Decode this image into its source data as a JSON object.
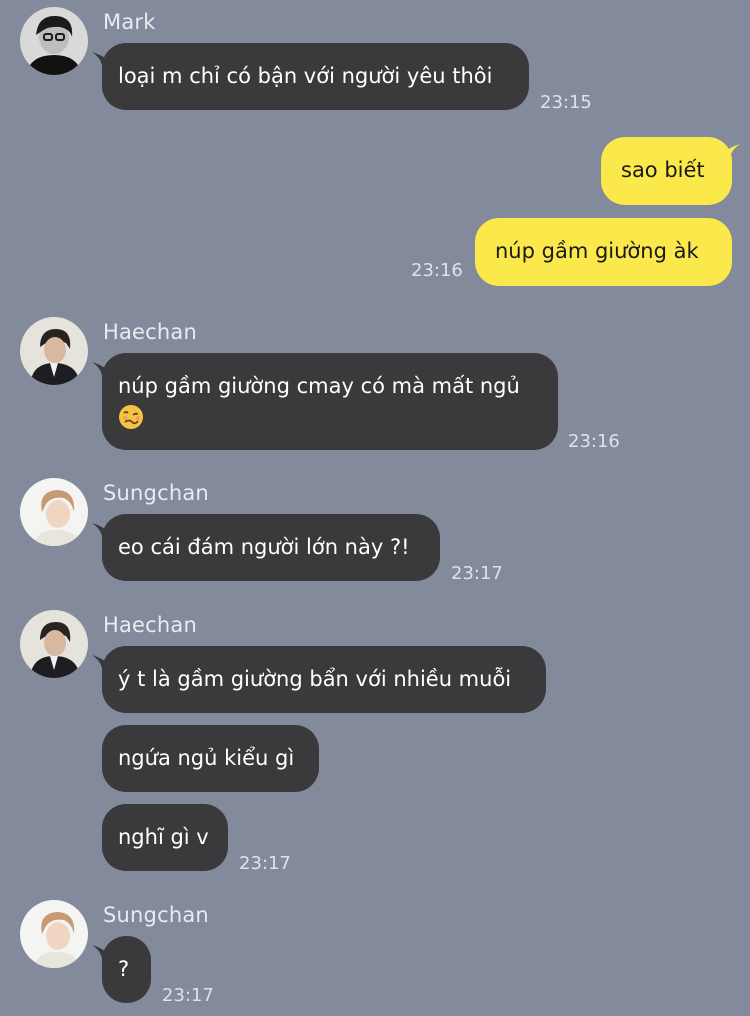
{
  "colors": {
    "background": "#838a9b",
    "incoming_bubble": "#3a3a3c",
    "outgoing_bubble": "#fbe84a",
    "name_text": "#e9ebf0",
    "time_text": "#dfe2e9"
  },
  "chat": {
    "mark": {
      "name": "Mark",
      "message": "loại m chỉ có bận với người yêu thôi",
      "time": "23:15"
    },
    "me": {
      "message_1": "sao biết",
      "message_2": "núp gầm giường àk",
      "time": "23:16"
    },
    "haechan_1": {
      "name": "Haechan",
      "message": "núp gầm giường cmay có mà mất ngủ",
      "emoji": "woozy-face-emoji",
      "time": "23:16"
    },
    "sungchan_1": {
      "name": "Sungchan",
      "message": "eo cái đám người lớn này ?!",
      "time": "23:17"
    },
    "haechan_2": {
      "name": "Haechan",
      "message_1": "ý t là gầm giường bẩn với nhiều muỗi",
      "message_2": "ngứa ngủ kiểu gì",
      "message_3": "nghĩ gì v",
      "time": "23:17"
    },
    "sungchan_2": {
      "name": "Sungchan",
      "message": "?",
      "time": "23:17"
    }
  }
}
